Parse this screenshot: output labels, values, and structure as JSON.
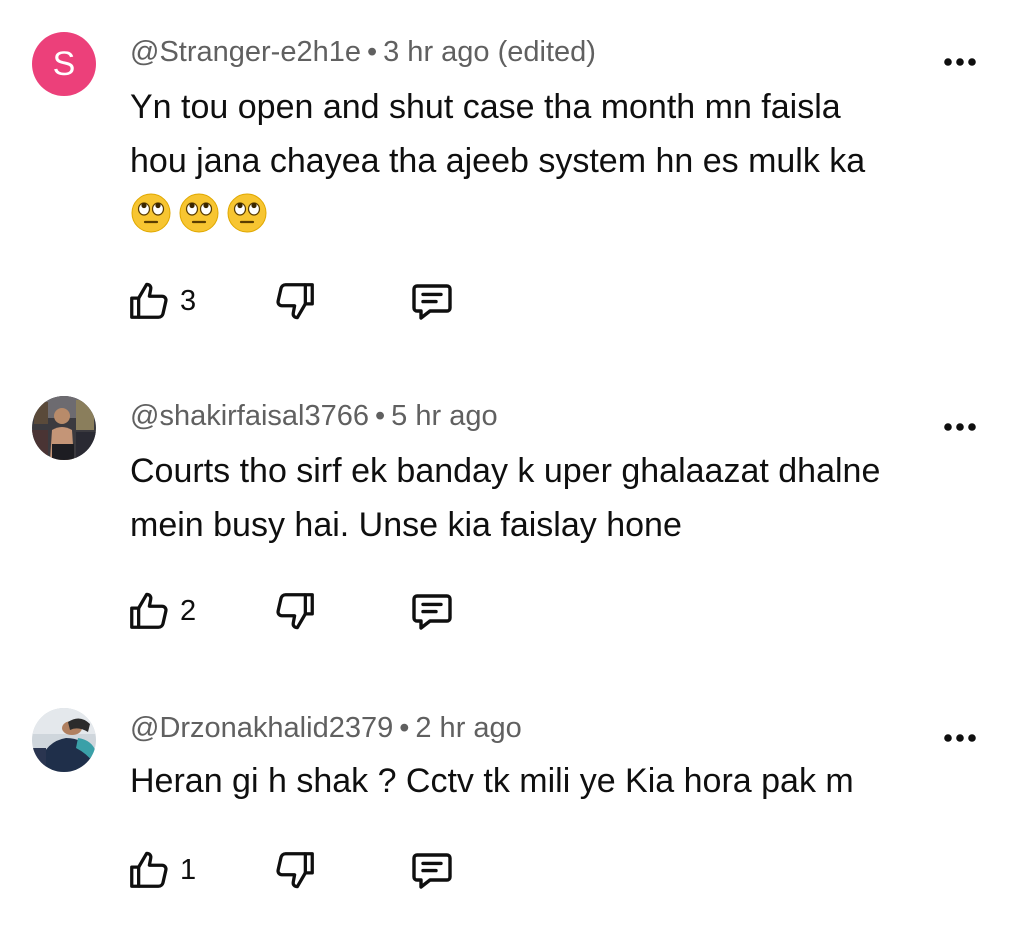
{
  "comments": [
    {
      "avatar_letter": "S",
      "avatar_color": "#ec407a",
      "handle": "@Stranger-e2h1e",
      "time": "3 hr ago (edited)",
      "text_lines": [
        "Yn tou open and shut case tha  month mn faisla",
        "hou jana chayea tha ajeeb system hn es mulk ka"
      ],
      "emojis": "🙄🙄🙄",
      "likes": "3"
    },
    {
      "avatar_letter": "",
      "handle": "@shakirfaisal3766",
      "time": "5 hr ago",
      "text_lines": [
        "Courts tho sirf ek banday k uper ghalaazat dhalne",
        "mein busy hai. Unse kia faislay hone"
      ],
      "likes": "2"
    },
    {
      "avatar_letter": "",
      "handle": "@Drzonakhalid2379",
      "time": "2 hr ago",
      "text_lines": [
        "Heran gi h shak ? Cctv tk mili ye Kia hora pak m"
      ],
      "likes": "1"
    }
  ],
  "separator": "•",
  "icons": {
    "like": "thumbs-up-icon",
    "dislike": "thumbs-down-icon",
    "reply": "comment-icon",
    "menu": "more-vert-icon"
  }
}
